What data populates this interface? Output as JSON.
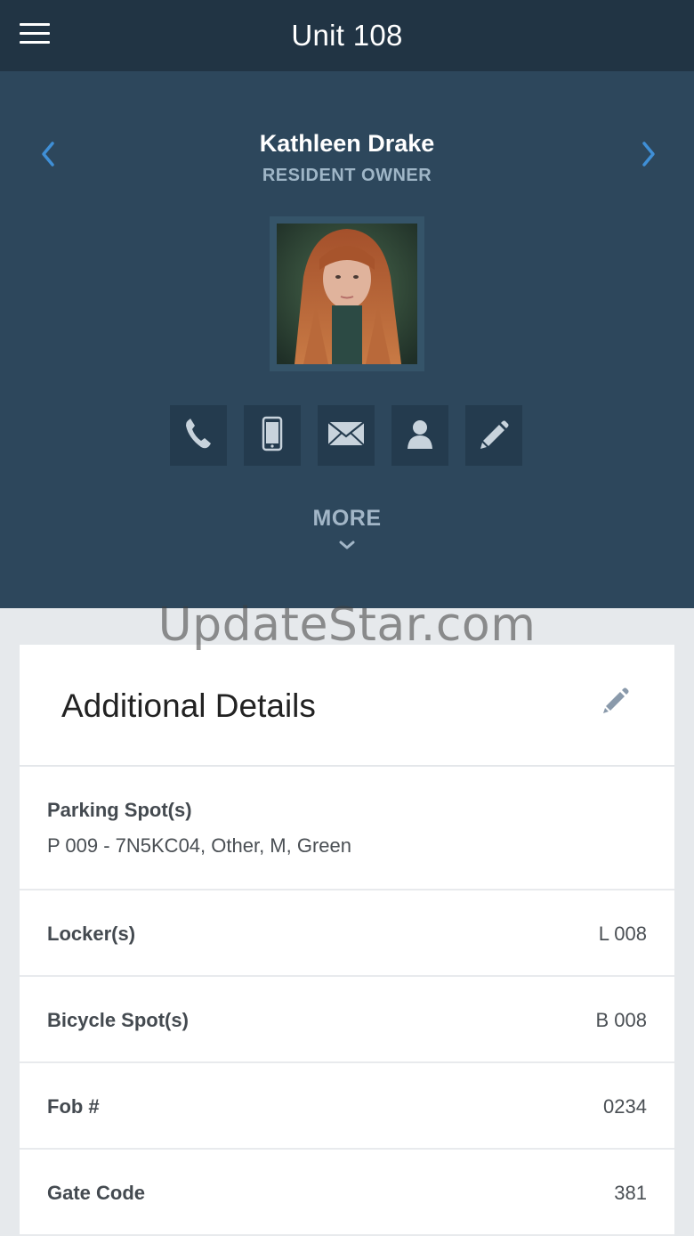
{
  "appbar": {
    "title": "Unit 108"
  },
  "profile": {
    "name": "Kathleen Drake",
    "role": "RESIDENT OWNER"
  },
  "actions": [
    {
      "icon": "phone-icon"
    },
    {
      "icon": "mobile-icon"
    },
    {
      "icon": "mail-icon"
    },
    {
      "icon": "contact-icon"
    },
    {
      "icon": "pencil-icon"
    }
  ],
  "more_label": "MORE",
  "watermark": "UpdateStar.com",
  "details": {
    "title": "Additional Details",
    "parking": {
      "label": "Parking Spot(s)",
      "value": "P 009 - 7N5KC04, Other, M, Green"
    },
    "locker": {
      "label": "Locker(s)",
      "value": "L 008"
    },
    "bicycle": {
      "label": "Bicycle Spot(s)",
      "value": "B 008"
    },
    "fob": {
      "label": "Fob #",
      "value": "0234"
    },
    "gate": {
      "label": "Gate Code",
      "value": "381"
    }
  },
  "colors": {
    "appbar": "#213444",
    "hero": "#2d475c",
    "accent_arrow": "#3f8fd6",
    "muted_label": "#9fb6c7"
  }
}
